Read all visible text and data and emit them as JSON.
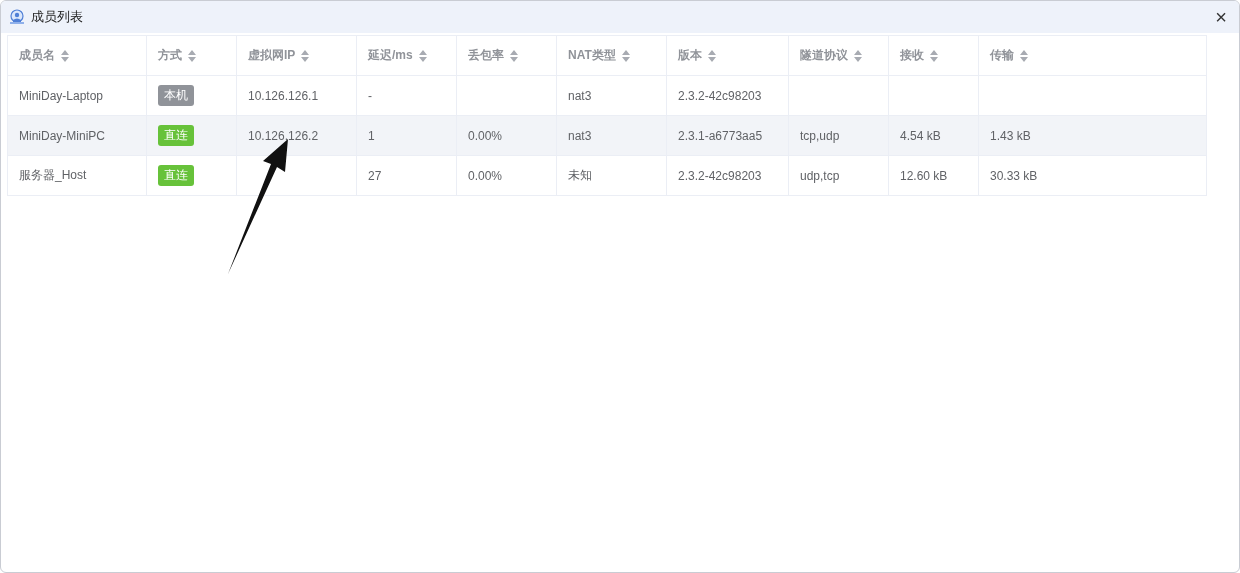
{
  "window": {
    "title": "成员列表",
    "close": "×"
  },
  "table": {
    "columns": [
      "成员名",
      "方式",
      "虚拟网IP",
      "延迟/ms",
      "丢包率",
      "NAT类型",
      "版本",
      "隧道协议",
      "接收",
      "传输"
    ],
    "rows": [
      {
        "highlighted": false,
        "cells": [
          "MiniDay-Laptop",
          {
            "kind": "local",
            "text": "本机"
          },
          "10.126.126.1",
          "-",
          "",
          "nat3",
          "2.3.2-42c98203",
          "",
          "",
          ""
        ]
      },
      {
        "highlighted": true,
        "cells": [
          "MiniDay-MiniPC",
          {
            "kind": "direct",
            "text": "直连"
          },
          "10.126.126.2",
          "1",
          "0.00%",
          "nat3",
          "2.3.1-a6773aa5",
          "tcp,udp",
          "4.54 kB",
          "1.43 kB"
        ]
      },
      {
        "highlighted": false,
        "cells": [
          "服务器_Host",
          {
            "kind": "direct",
            "text": "直连"
          },
          "",
          "27",
          "0.00%",
          "未知",
          "2.3.2-42c98203",
          "udp,tcp",
          "12.60 kB",
          "30.33 kB"
        ]
      }
    ]
  }
}
